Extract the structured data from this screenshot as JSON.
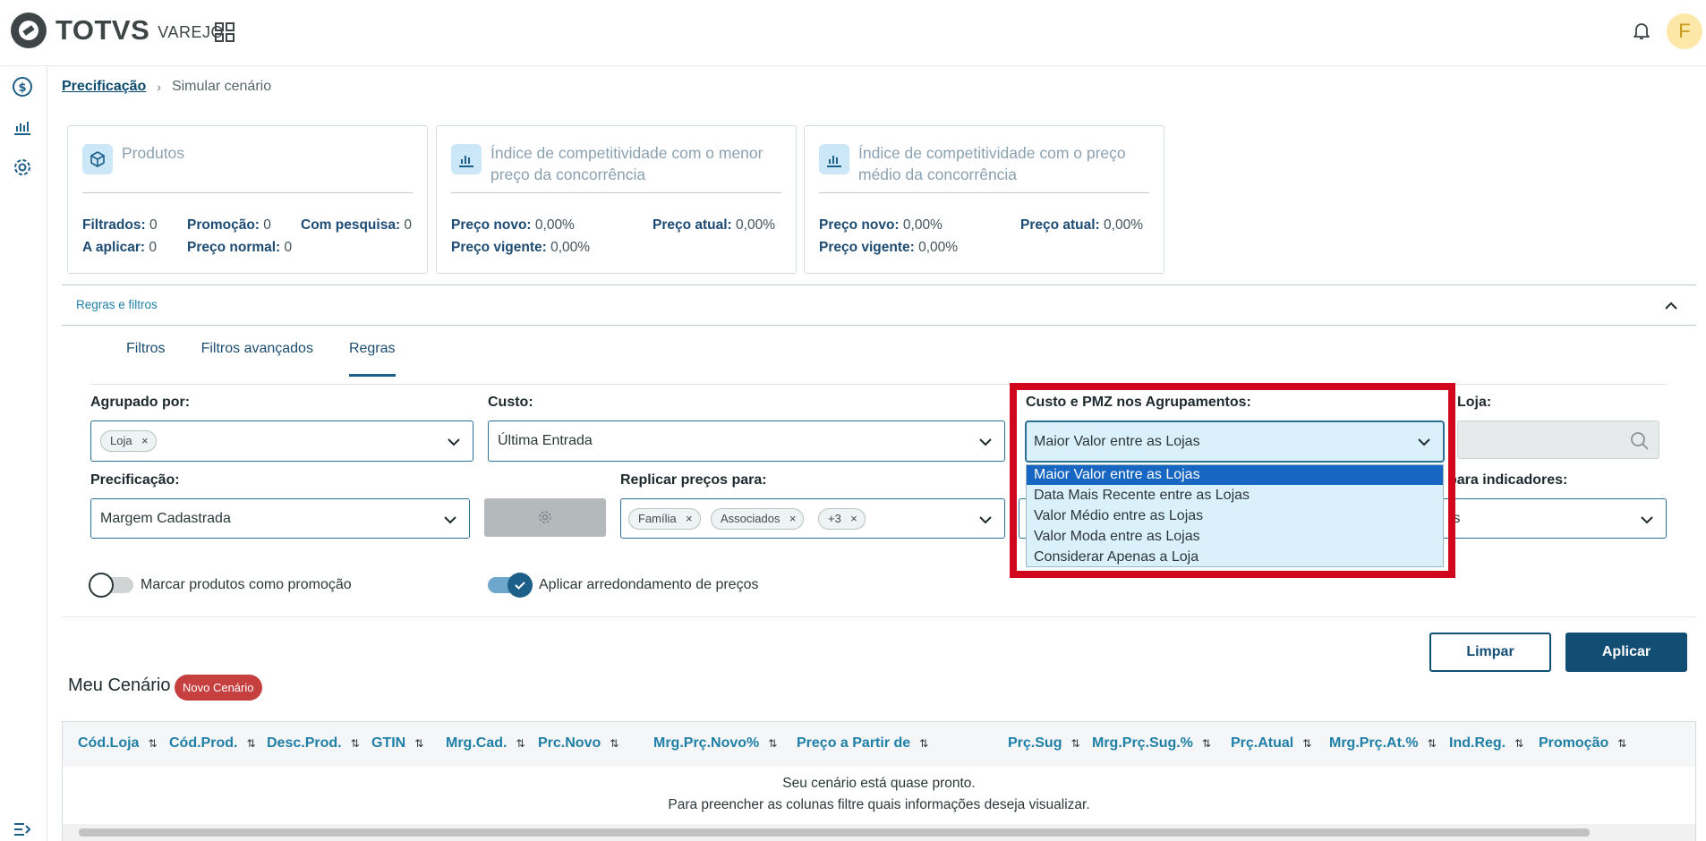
{
  "app": {
    "brand": "TOTVS",
    "product": "VAREJO",
    "avatar_initial": "F"
  },
  "breadcrumb": {
    "root": "Precificação",
    "current": "Simular cenário"
  },
  "cards": {
    "produtos": {
      "title": "Produtos",
      "filtrados_label": "Filtrados:",
      "filtrados": "0",
      "promocao_label": "Promoção:",
      "promocao": "0",
      "com_pesquisa_label": "Com pesquisa:",
      "com_pesquisa": "0",
      "a_aplicar_label": "A aplicar:",
      "a_aplicar": "0",
      "preco_normal_label": "Preço normal:",
      "preco_normal": "0"
    },
    "menor": {
      "title": "Índice de competitividade com o menor preço da concorrência",
      "preco_novo_label": "Preço novo:",
      "preco_novo": "0,00%",
      "preco_atual_label": "Preço atual:",
      "preco_atual": "0,00%",
      "preco_vigente_label": "Preço vigente:",
      "preco_vigente": "0,00%"
    },
    "medio": {
      "title": "Índice de competitividade com o preço médio da concorrência",
      "preco_novo_label": "Preço novo:",
      "preco_novo": "0,00%",
      "preco_atual_label": "Preço atual:",
      "preco_atual": "0,00%",
      "preco_vigente_label": "Preço vigente:",
      "preco_vigente": "0,00%"
    }
  },
  "rules_panel": {
    "title": "Regras e filtros"
  },
  "tabs": [
    "Filtros",
    "Filtros avançados",
    "Regras"
  ],
  "form": {
    "agrupado_label": "Agrupado por:",
    "agrupado_tag": "Loja",
    "custo_label": "Custo:",
    "custo_value": "Última Entrada",
    "loja_label": "Loja:",
    "precificacao_label": "Precificação:",
    "precificacao_value": "Margem Cadastrada",
    "replicar_label": "Replicar preços para:",
    "replicar_tags": [
      "Família",
      "Associados",
      "+3"
    ],
    "indicadores_label": "para indicadores:",
    "indicadores_value": "is",
    "promo_toggle_label": "Marcar produtos como promoção",
    "promo_toggle_on": false,
    "arred_toggle_label": "Aplicar arredondamento de preços",
    "arred_toggle_on": true
  },
  "dropdown": {
    "label": "Custo e PMZ nos Agrupamentos:",
    "value": "Maior Valor entre as Lojas",
    "options": [
      "Maior Valor entre as Lojas",
      "Data Mais Recente entre as Lojas",
      "Valor Médio entre as Lojas",
      "Valor Moda entre as Lojas",
      "Considerar Apenas a Loja"
    ],
    "selected_index": 0
  },
  "buttons": {
    "limpar": "Limpar",
    "aplicar": "Aplicar"
  },
  "scenario": {
    "title": "Meu Cenário",
    "badge": "Novo Cenário"
  },
  "table": {
    "columns": [
      "Cód.Loja",
      "Cód.Prod.",
      "Desc.Prod.",
      "GTIN",
      "Mrg.Cad.",
      "Prc.Novo",
      "Mrg.Prç.Novo%",
      "Preço a Partir de",
      "Prç.Sug",
      "Mrg.Prç.Sug.%",
      "Prç.Atual",
      "Mrg.Prç.At.%",
      "Ind.Reg.",
      "Promoção"
    ],
    "empty_line1": "Seu cenário está quase pronto.",
    "empty_line2": "Para preencher as colunas filtre quais informações deseja visualizar."
  },
  "colors": {
    "primary": "#124e74",
    "highlight_frame": "#d1081d",
    "badge": "#c64040",
    "link": "#1f7fa6"
  }
}
